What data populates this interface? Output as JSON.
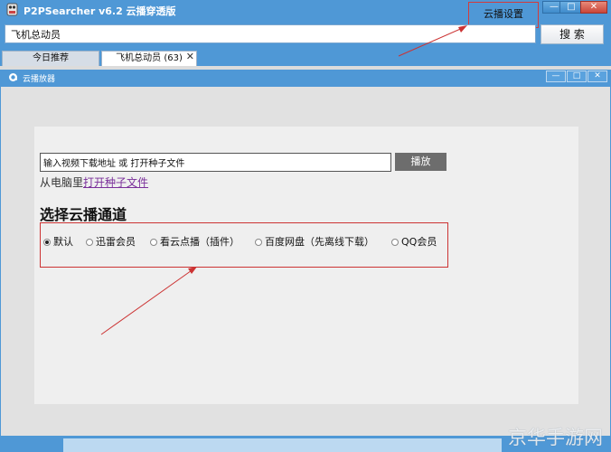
{
  "app": {
    "title": "P2PSearcher v6.2 云播穿透版",
    "settings_label": "云播设置",
    "minimize_glyph": "—",
    "maximize_glyph": "□",
    "close_glyph": "✕"
  },
  "search": {
    "value": "飞机总动员",
    "button_label": "搜 索"
  },
  "tabs": [
    {
      "label": "今日推荐"
    },
    {
      "label": "飞机总动员 (63)",
      "close_glyph": "✕"
    }
  ],
  "player": {
    "window_title": "云播放器",
    "url_placeholder": "输入视频下载地址 或 打开种子文件",
    "play_label": "播放",
    "open_prefix": "从电脑里",
    "open_link": "打开种子文件",
    "section_title": "选择云播通道",
    "channels": [
      {
        "label": "默认",
        "selected": true
      },
      {
        "label": "迅雷会员",
        "selected": false
      },
      {
        "label": "看云点播（插件）",
        "selected": false
      },
      {
        "label": "百度网盘（先离线下载）",
        "selected": false
      },
      {
        "label": "QQ会员",
        "selected": false
      }
    ]
  },
  "watermark": "京华手游网",
  "colors": {
    "accent": "#4f98d6",
    "annotation": "#cc3333"
  }
}
